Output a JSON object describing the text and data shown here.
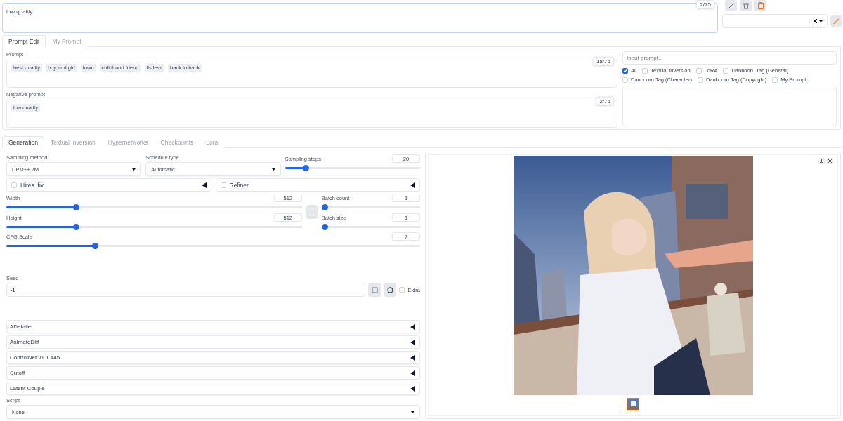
{
  "top_prompt": {
    "value": "low quality",
    "counter": "2/75"
  },
  "editor_tabs": [
    {
      "label": "Prompt Edit",
      "selected": true
    },
    {
      "label": "My Prompt",
      "selected": false
    }
  ],
  "prompt": {
    "label": "Prompt",
    "counter": "18/75",
    "tags": [
      "best quality",
      "boy and girl",
      "town",
      "childhood friend",
      "listless",
      "back to back"
    ]
  },
  "negative_prompt": {
    "label": "Negative prompt",
    "counter": "2/75",
    "tags": [
      "low quality"
    ]
  },
  "tag_search": {
    "placeholder": "Input prompt...",
    "filters": [
      {
        "label": "All",
        "checked": true
      },
      {
        "label": "Textual Inversion",
        "checked": false
      },
      {
        "label": "LoRA",
        "checked": false
      },
      {
        "label": "Danbooru Tag (General)",
        "checked": false
      },
      {
        "label": "Danbooru Tag (Character)",
        "checked": false
      },
      {
        "label": "Danbooru Tag (Copyright)",
        "checked": false
      },
      {
        "label": "My Prompt",
        "checked": false
      }
    ]
  },
  "main_tabs": [
    {
      "label": "Generation",
      "selected": true
    },
    {
      "label": "Textual Inversion",
      "selected": false
    },
    {
      "label": "Hypernetworks",
      "selected": false
    },
    {
      "label": "Checkpoints",
      "selected": false
    },
    {
      "label": "Lora",
      "selected": false
    }
  ],
  "sampling_method": {
    "label": "Sampling method",
    "value": "DPM++ 2M"
  },
  "schedule_type": {
    "label": "Schedule type",
    "value": "Automatic"
  },
  "sampling_steps": {
    "label": "Sampling steps",
    "value": "20",
    "level": 0.14
  },
  "toggles": [
    {
      "label": "Hires. fix",
      "checked": false
    },
    {
      "label": "Refiner",
      "checked": false
    }
  ],
  "width": {
    "label": "Width",
    "value": "512",
    "level": 0.23
  },
  "height": {
    "label": "Height",
    "value": "512",
    "level": 0.23
  },
  "batch_count": {
    "label": "Batch count",
    "value": "1",
    "level": 0
  },
  "batch_size": {
    "label": "Batch size",
    "value": "1",
    "level": 0
  },
  "cfg_scale": {
    "label": "CFG Scale",
    "value": "7",
    "level": 0.21
  },
  "seed": {
    "label": "Seed",
    "value": "-1",
    "extra": {
      "label": "Extra",
      "checked": false
    }
  },
  "accordions": [
    {
      "label": "ADetailer",
      "expanded": false
    },
    {
      "label": "AnimateDiff",
      "expanded": false
    },
    {
      "label": "ControlNet v1.1.445",
      "expanded": false
    },
    {
      "label": "Cutoff",
      "expanded": false
    },
    {
      "label": "Latent Couple",
      "expanded": false
    }
  ],
  "script": {
    "label": "Script",
    "value": "None"
  },
  "output": {
    "thumbnails": [
      {
        "selected": true
      }
    ]
  }
}
